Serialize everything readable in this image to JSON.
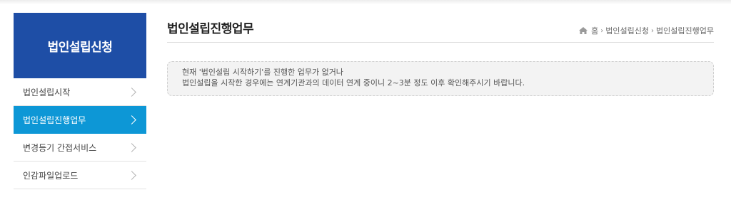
{
  "sidebar": {
    "title": "법인설립신청",
    "items": [
      {
        "label": "법인설립시작",
        "active": false
      },
      {
        "label": "법인설립진행업무",
        "active": true
      },
      {
        "label": "변경등기 간접서비스",
        "active": false
      },
      {
        "label": "인감파일업로드",
        "active": false
      }
    ]
  },
  "header": {
    "title": "법인설립진행업무",
    "breadcrumb": [
      "홈",
      "법인설립신청",
      "법인설립진행업무"
    ]
  },
  "notice": {
    "line1": "현재 '법인설립 시작하기'를 진행한 업무가 없거나",
    "line2": "법인설립을 시작한 경우에는 연계기관과의 데이터 연계 중이니 2~3분 정도 이후 확인해주시기 바랍니다."
  },
  "icons": {
    "home": "home-icon",
    "chevron": "chevron-right-icon"
  },
  "colors": {
    "sidebar_header": "#1e4ea6",
    "active_item": "#0d97d6"
  }
}
